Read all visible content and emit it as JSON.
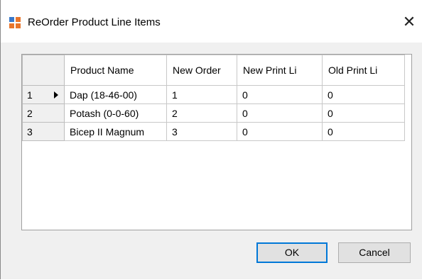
{
  "window": {
    "title": "ReOrder Product Line Items",
    "close_glyph": "✕"
  },
  "grid": {
    "columns": [
      "Product Name",
      "New Order",
      "New Print Li",
      "Old Print Li"
    ],
    "rows": [
      {
        "num": "1",
        "cells": [
          "Dap (18-46-00)",
          "1",
          "0",
          "0"
        ],
        "current": true
      },
      {
        "num": "2",
        "cells": [
          "Potash (0-0-60)",
          "2",
          "0",
          "0"
        ]
      },
      {
        "num": "3",
        "cells": [
          "Bicep II Magnum",
          "3",
          "0",
          "0"
        ]
      }
    ]
  },
  "buttons": {
    "ok": "OK",
    "cancel": "Cancel"
  },
  "colors": {
    "accent": "#0078d7",
    "icon_orange": "#e8752b",
    "icon_blue": "#3a78c9"
  }
}
